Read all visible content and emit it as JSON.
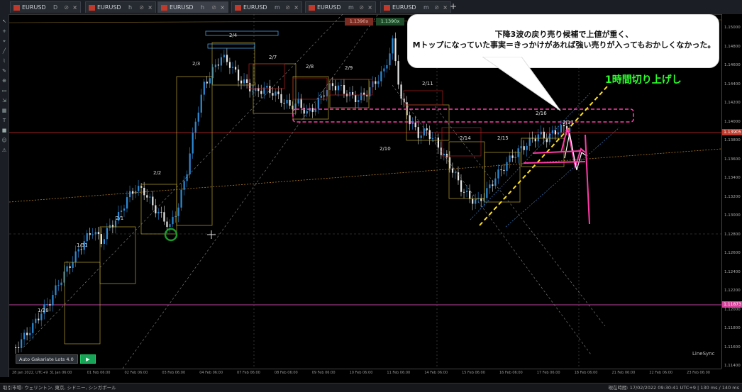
{
  "tabs": [
    {
      "name": "EURUSD",
      "tf": "D",
      "active": false
    },
    {
      "name": "EURUSD",
      "tf": "h",
      "active": false
    },
    {
      "name": "EURUSD",
      "tf": "h",
      "active": true
    },
    {
      "name": "EURUSD",
      "tf": "m",
      "active": false
    },
    {
      "name": "EURUSD",
      "tf": "m",
      "active": false
    },
    {
      "name": "EURUSD",
      "tf": "m",
      "active": false
    }
  ],
  "annotation": {
    "line1": "下降3波の戻り売り候補で上値が重く、",
    "line2": "Mトップになっていた事実＝きっかけがあれば強い売りが入ってもおかしくなかった。",
    "green_label": "1時間切り上げし"
  },
  "price_boxes": {
    "buy": "1.1390x",
    "sell": "1.1390x"
  },
  "current_price": "1.13905",
  "pink_price": "1.11873",
  "y_ticks": [
    "1.15000",
    "1.14800",
    "1.14600",
    "1.14400",
    "1.14200",
    "1.14000",
    "1.13800",
    "1.13600",
    "1.13400",
    "1.13200",
    "1.13000",
    "1.12800",
    "1.12600",
    "1.12400",
    "1.12200",
    "1.12000",
    "1.11800",
    "1.11600",
    "1.11400"
  ],
  "x_ticks": [
    "28 Jan 2022, UTC+9",
    "31 Jan 06:00",
    "01 Feb 06:00",
    "02 Feb 06:00",
    "03 Feb 06:00",
    "04 Feb 06:00",
    "07 Feb 06:00",
    "08 Feb 06:00",
    "09 Feb 06:00",
    "10 Feb 06:00",
    "11 Feb 06:00",
    "14 Feb 06:00",
    "15 Feb 06:00",
    "16 Feb 06:00",
    "17 Feb 06:00",
    "18 Feb 06:00",
    "21 Feb 06:00",
    "22 Feb 06:00",
    "23 Feb 06:00"
  ],
  "day_labels": [
    {
      "t": "1/28"
    },
    {
      "t": "1/31"
    },
    {
      "t": "2/1"
    },
    {
      "t": "2/2"
    },
    {
      "t": "2/3"
    },
    {
      "t": "2/4"
    },
    {
      "t": "2/7"
    },
    {
      "t": "2/8"
    },
    {
      "t": "2/9"
    },
    {
      "t": "2/10"
    },
    {
      "t": "2/11"
    },
    {
      "t": "2/14"
    },
    {
      "t": "2/15"
    },
    {
      "t": "2/16"
    },
    {
      "t": "2/17"
    }
  ],
  "auto_button": "Auto Gakariate Lots 4.0",
  "play_icon": "play-icon",
  "linesync": "LineSync",
  "status_left": "取引市場: ウェリントン, 東京, シドニー, シンガポール",
  "status_right": "現在時間: 17/02/2022 09:30:41   UTC+9   |  130 ms / 140 ms",
  "colors": {
    "bull": "#2d8bd8",
    "bear": "#e8e8e8",
    "pink": "#ff3aa8",
    "yellow": "#ffe01a",
    "green": "#2cff2c"
  }
}
